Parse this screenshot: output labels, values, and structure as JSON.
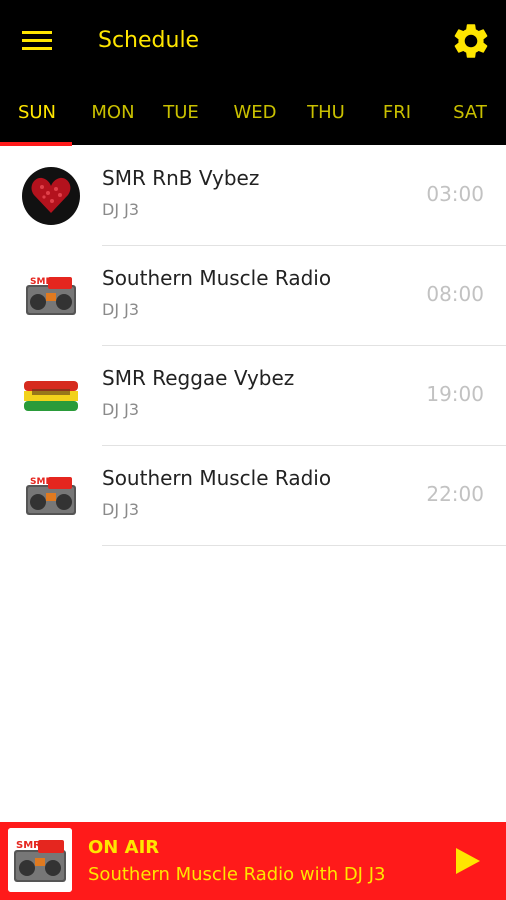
{
  "header": {
    "title": "Schedule",
    "menu_icon": "hamburger-menu-icon",
    "settings_icon": "gear-icon"
  },
  "tabs": [
    {
      "label": "SUN",
      "active": true
    },
    {
      "label": "MON",
      "active": false
    },
    {
      "label": "TUE",
      "active": false
    },
    {
      "label": "WED",
      "active": false
    },
    {
      "label": "THU",
      "active": false
    },
    {
      "label": "FRI",
      "active": false
    },
    {
      "label": "SAT",
      "active": false
    }
  ],
  "schedule": [
    {
      "title": "SMR RnB Vybez",
      "host": "DJ J3",
      "time": "03:00",
      "thumb": "heart-logo"
    },
    {
      "title": "Southern Muscle Radio",
      "host": "DJ J3",
      "time": "08:00",
      "thumb": "boombox-logo"
    },
    {
      "title": "SMR Reggae Vybez",
      "host": "DJ J3",
      "time": "19:00",
      "thumb": "reggae-logo"
    },
    {
      "title": "Southern Muscle Radio",
      "host": "DJ J3",
      "time": "22:00",
      "thumb": "boombox-logo"
    }
  ],
  "player": {
    "status": "ON AIR",
    "now_playing": "Southern Muscle Radio with DJ J3",
    "play_icon": "play-icon"
  },
  "colors": {
    "accent_yellow": "#ffe600",
    "accent_red": "#ff1a1a",
    "header_bg": "#000000"
  }
}
